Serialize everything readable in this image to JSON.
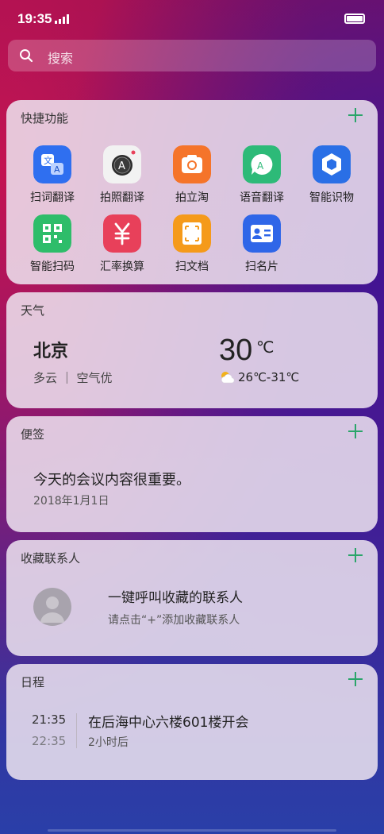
{
  "status": {
    "time": "19:35"
  },
  "search": {
    "placeholder": "搜索"
  },
  "quick": {
    "title": "快捷功能",
    "items": [
      {
        "label": "扫词翻译",
        "icon": "scan-translate-icon",
        "color": "#2f6ff0"
      },
      {
        "label": "拍照翻译",
        "icon": "camera-translate-icon",
        "color": "#f2f2f2"
      },
      {
        "label": "拍立淘",
        "icon": "camera-icon",
        "color": "#f5742a"
      },
      {
        "label": "语音翻译",
        "icon": "voice-translate-icon",
        "color": "#2dba78"
      },
      {
        "label": "智能识物",
        "icon": "object-recognition-icon",
        "color": "#2a6fe6"
      },
      {
        "label": "智能扫码",
        "icon": "qr-scan-icon",
        "color": "#2ebd6a"
      },
      {
        "label": "汇率换算",
        "icon": "currency-icon",
        "color": "#e8405a"
      },
      {
        "label": "扫文档",
        "icon": "scan-document-icon",
        "color": "#f59a1a"
      },
      {
        "label": "扫名片",
        "icon": "business-card-icon",
        "color": "#2f66e8"
      }
    ]
  },
  "weather": {
    "title": "天气",
    "city": "北京",
    "condition": "多云 ｜ 空气优",
    "temp": "30",
    "unit": "℃",
    "range": "26℃-31℃"
  },
  "note": {
    "title": "便签",
    "text": "今天的会议内容很重要。",
    "date": "2018年1月1日"
  },
  "contacts": {
    "title": "收藏联系人",
    "main": "一键呼叫收藏的联系人",
    "sub": "请点击“+”添加收藏联系人"
  },
  "schedule": {
    "title": "日程",
    "start": "21:35",
    "end": "22:35",
    "event": "在后海中心六楼601楼开会",
    "relative": "2小时后"
  }
}
